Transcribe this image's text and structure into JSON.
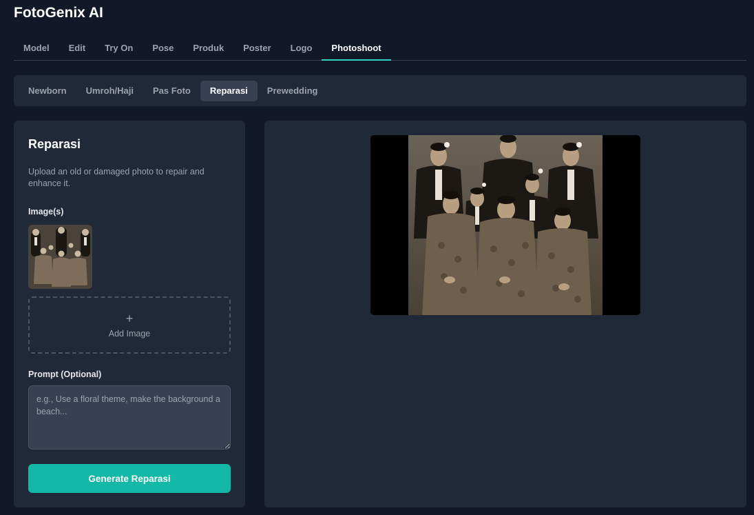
{
  "app": {
    "title": "FotoGenix AI"
  },
  "main_tabs": [
    {
      "label": "Model"
    },
    {
      "label": "Edit"
    },
    {
      "label": "Try On"
    },
    {
      "label": "Pose"
    },
    {
      "label": "Produk"
    },
    {
      "label": "Poster"
    },
    {
      "label": "Logo"
    },
    {
      "label": "Photoshoot",
      "active": true
    }
  ],
  "sub_tabs": [
    {
      "label": "Newborn"
    },
    {
      "label": "Umroh/Haji"
    },
    {
      "label": "Pas Foto"
    },
    {
      "label": "Reparasi",
      "active": true
    },
    {
      "label": "Prewedding"
    }
  ],
  "form": {
    "title": "Reparasi",
    "description": "Upload an old or damaged photo to repair and enhance it.",
    "images_label": "Image(s)",
    "add_image_icon": "plus-icon",
    "add_image_label": "Add Image",
    "prompt_label": "Prompt (Optional)",
    "prompt_value": "",
    "prompt_placeholder": "e.g., Use a floral theme, make the background a beach...",
    "generate_label": "Generate Reparasi"
  },
  "colors": {
    "background": "#111827",
    "panel": "#1f2937",
    "accent": "#14b8a6",
    "active_tab_underline": "#2dd4bf"
  }
}
